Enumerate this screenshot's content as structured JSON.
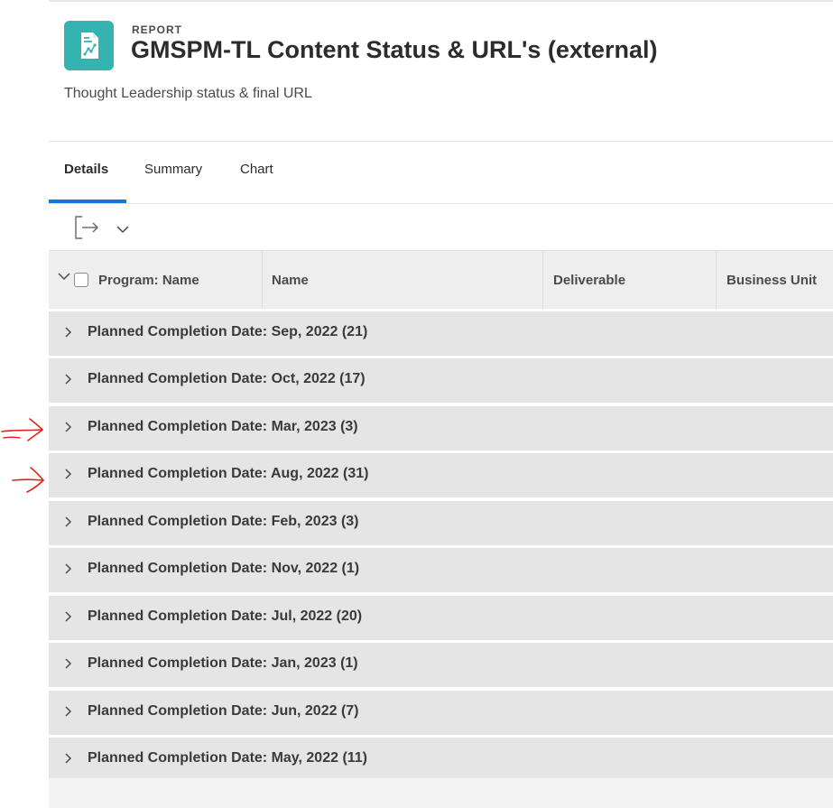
{
  "header": {
    "eyebrow": "REPORT",
    "title": "GMSPM-TL Content Status & URL's (external)",
    "subtitle": "Thought Leadership status & final URL",
    "icon": "report-chart-icon",
    "icon_color": "#34b3b0"
  },
  "tabs": [
    {
      "label": "Details",
      "active": true
    },
    {
      "label": "Summary",
      "active": false
    },
    {
      "label": "Chart",
      "active": false
    }
  ],
  "toolbar": {
    "export_icon": "export-icon",
    "dropdown_icon": "chevron-down-icon"
  },
  "table": {
    "columns": [
      "Program: Name",
      "Name",
      "Deliverable",
      "Business Unit"
    ],
    "groups": [
      {
        "label": "Planned Completion Date: Sep, 2022 (21)"
      },
      {
        "label": "Planned Completion Date: Oct, 2022 (17)"
      },
      {
        "label": "Planned Completion Date: Mar, 2023 (3)"
      },
      {
        "label": "Planned Completion Date: Aug, 2022 (31)"
      },
      {
        "label": "Planned Completion Date: Feb, 2023 (3)"
      },
      {
        "label": "Planned Completion Date: Nov, 2022 (1)"
      },
      {
        "label": "Planned Completion Date: Jul, 2022 (20)"
      },
      {
        "label": "Planned Completion Date: Jan, 2023 (1)"
      },
      {
        "label": "Planned Completion Date: Jun, 2022 (7)"
      },
      {
        "label": "Planned Completion Date: May, 2022 (11)"
      }
    ]
  },
  "colors": {
    "accent": "#1473e6",
    "row_background": "#e5e5e5",
    "annotation": "#e0231b"
  }
}
